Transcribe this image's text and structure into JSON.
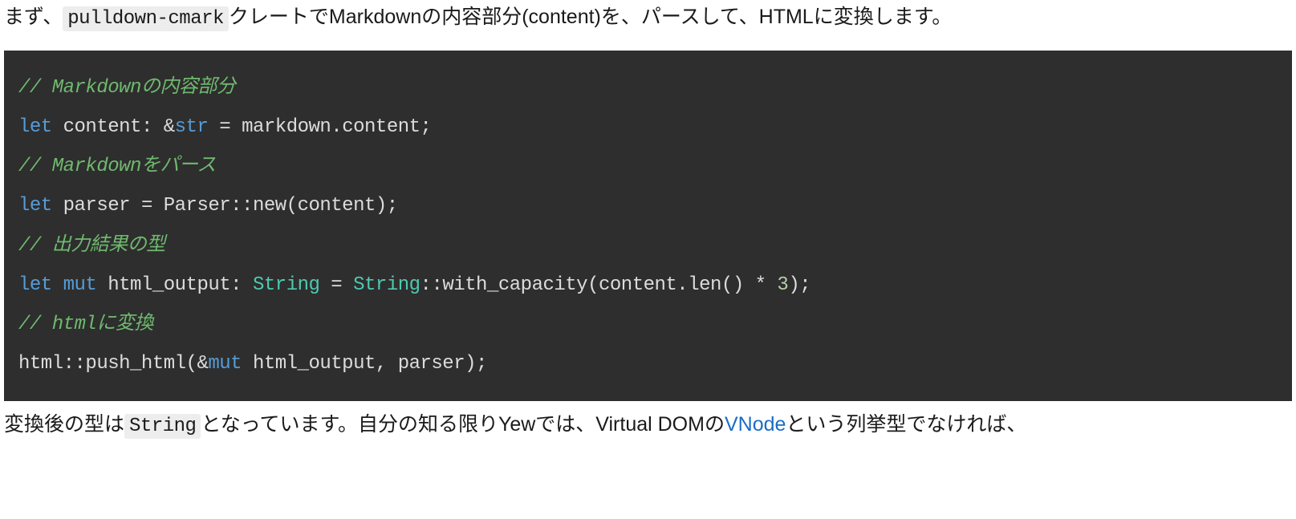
{
  "para1": {
    "t1": "まず、",
    "code": "pulldown-cmark",
    "t2": "クレートでMarkdownの内容部分(content)を、パースして、HTMLに変換します。"
  },
  "code": {
    "c1": "// Markdownの内容部分",
    "l2_let": "let",
    "l2_a": " content: &",
    "l2_str": "str",
    "l2_b": " = markdown.content;",
    "c3": "// Markdownをパース",
    "l4_let": "let",
    "l4_a": " parser = Parser::new(content);",
    "c5": "// 出力結果の型",
    "l6_let": "let",
    "l6_sp": " ",
    "l6_mut": "mut",
    "l6_a": " html_output: ",
    "l6_ty1": "String",
    "l6_b": " = ",
    "l6_ty2": "String",
    "l6_c": "::with_capacity(content.len() * ",
    "l6_num": "3",
    "l6_d": ");",
    "c7": "// htmlに変換",
    "l8_a": "html::push_html(&",
    "l8_mut": "mut",
    "l8_b": " html_output, parser);"
  },
  "para2": {
    "t1": "変換後の型は",
    "code": "String",
    "t2": "となっています。自分の知る限りYewでは、Virtual DOMの",
    "link": "VNode",
    "t3": "という列挙型でなければ、"
  }
}
